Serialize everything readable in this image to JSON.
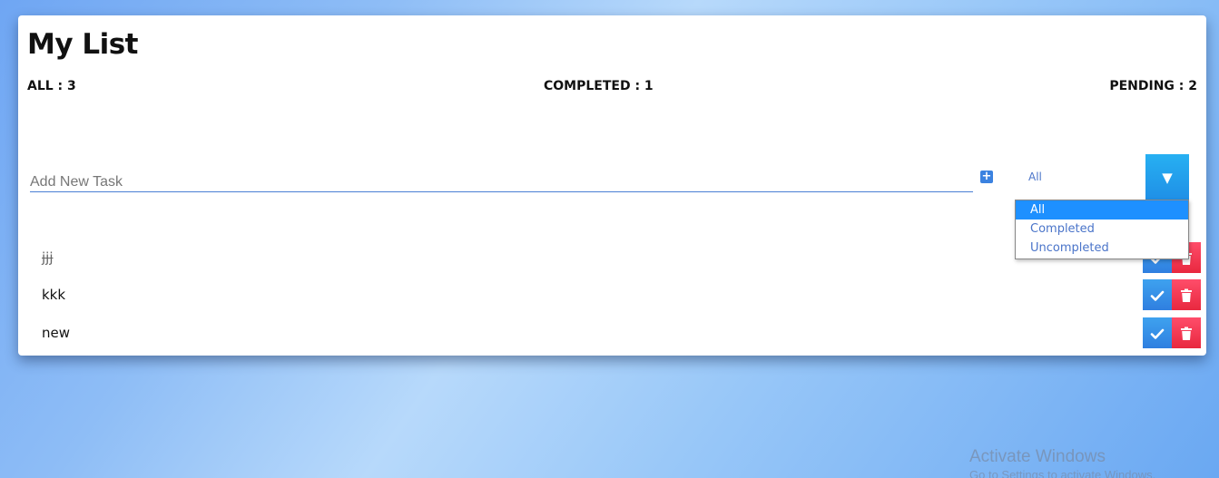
{
  "app": {
    "title": "My List"
  },
  "counts": {
    "all": "ALL : 3",
    "completed": "COMPLETED : 1",
    "pending": "PENDING : 2"
  },
  "input": {
    "placeholder": "Add New Task",
    "value": ""
  },
  "add_button": {
    "icon": "plus-square-icon",
    "glyph": "+"
  },
  "filter": {
    "selected": "All",
    "arrow_glyph": "▼",
    "options": [
      {
        "label": "All",
        "selected": true
      },
      {
        "label": "Completed",
        "selected": false
      },
      {
        "label": "Uncompleted",
        "selected": false
      }
    ]
  },
  "tasks": [
    {
      "text": "jjj",
      "completed": true
    },
    {
      "text": "kkk",
      "completed": false
    },
    {
      "text": "new",
      "completed": false
    }
  ],
  "actions": {
    "complete_icon": "check-icon",
    "delete_icon": "trash-icon"
  },
  "colors": {
    "accent": "#1e90ff",
    "check_button": "#2f7fe0",
    "delete_button": "#e8283f",
    "select_text": "#4a74c9"
  },
  "watermark": {
    "title": "Activate Windows",
    "subtitle": "Go to Settings to activate Windows."
  }
}
